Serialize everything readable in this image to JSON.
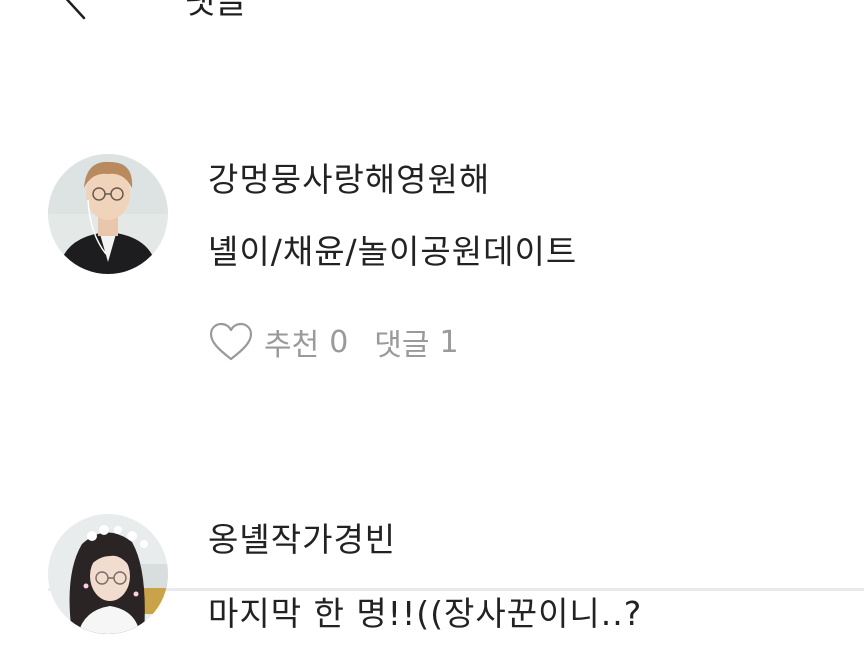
{
  "header": {
    "title": "댓글"
  },
  "comments": [
    {
      "nickname": "강멍뭉사랑해영원해",
      "text": "녤이/채윤/놀이공원데이트",
      "like_label": "추천",
      "like_count": "0",
      "reply_label": "댓글",
      "reply_count": "1"
    },
    {
      "nickname": "옹녤작가경빈",
      "text": "마지막 한 명!!((장사꾼이니..?"
    }
  ],
  "colors": {
    "text": "#222222",
    "meta": "#9a9a9a",
    "divider": "#e8ebed",
    "background": "#ffffff"
  }
}
